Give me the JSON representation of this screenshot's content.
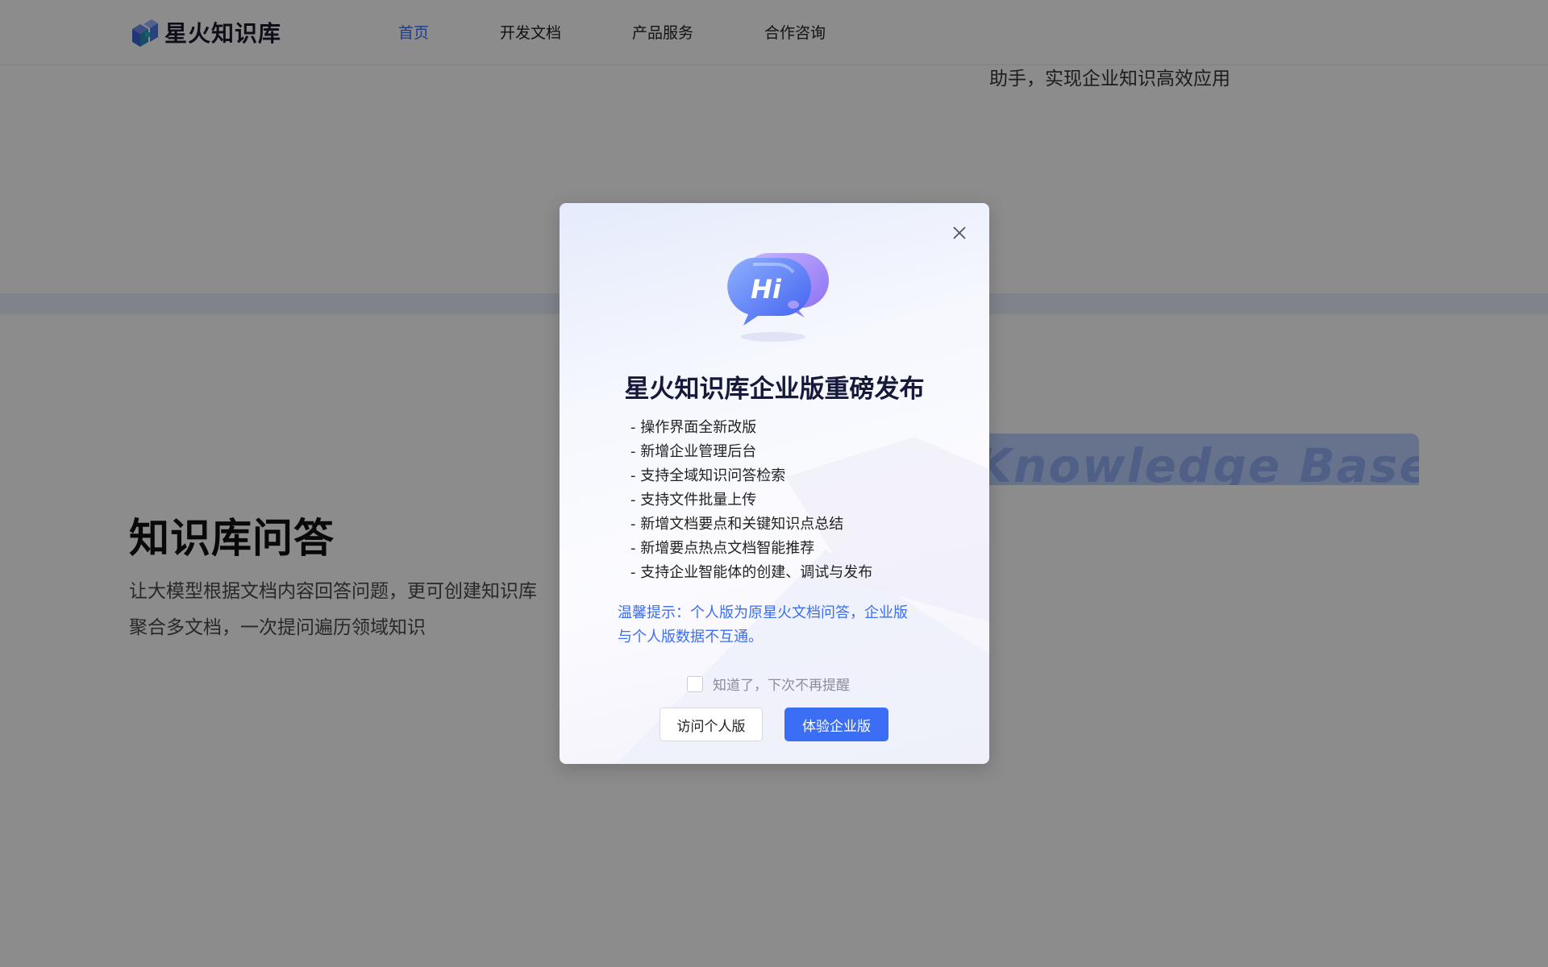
{
  "header": {
    "brand": "星火知识库",
    "nav": [
      {
        "label": "首页",
        "active": true
      },
      {
        "label": "开发文档",
        "active": false
      },
      {
        "label": "产品服务",
        "active": false
      },
      {
        "label": "合作咨询",
        "active": false
      }
    ]
  },
  "background": {
    "hero_tail": "助手，实现企业知识高效应用",
    "section_title": "知识库问答",
    "section_desc_lines": [
      "让大模型根据文档内容回答问题，更可创建知识库",
      "聚合多文档，一次提问遍历领域知识"
    ],
    "card_text": "Knowledge Base Q&A"
  },
  "modal": {
    "title": "星火知识库企业版重磅发布",
    "features": [
      "- 操作界面全新改版",
      "- 新增企业管理后台",
      "- 支持全域知识问答检索",
      "- 支持文件批量上传",
      "- 新增文档要点和关键知识点总结",
      "- 新增要点热点文档智能推荐",
      "- 支持企业智能体的创建、调试与发布"
    ],
    "tip_lines": [
      "温馨提示：个人版为原星火文档问答，企业版",
      "与个人版数据不互通。"
    ],
    "remind_label": "知道了，下次不再提醒",
    "remind_checked": false,
    "button_personal": "访问个人版",
    "button_enterprise": "体验企业版",
    "hi_badge": "Hi"
  },
  "colors": {
    "accent": "#3b6ef5",
    "title": "#16193a",
    "overlay": "rgba(0,0,0,0.45)"
  },
  "icons": [
    "logo-icon",
    "close-icon",
    "hi-chat-bubble-icon"
  ]
}
